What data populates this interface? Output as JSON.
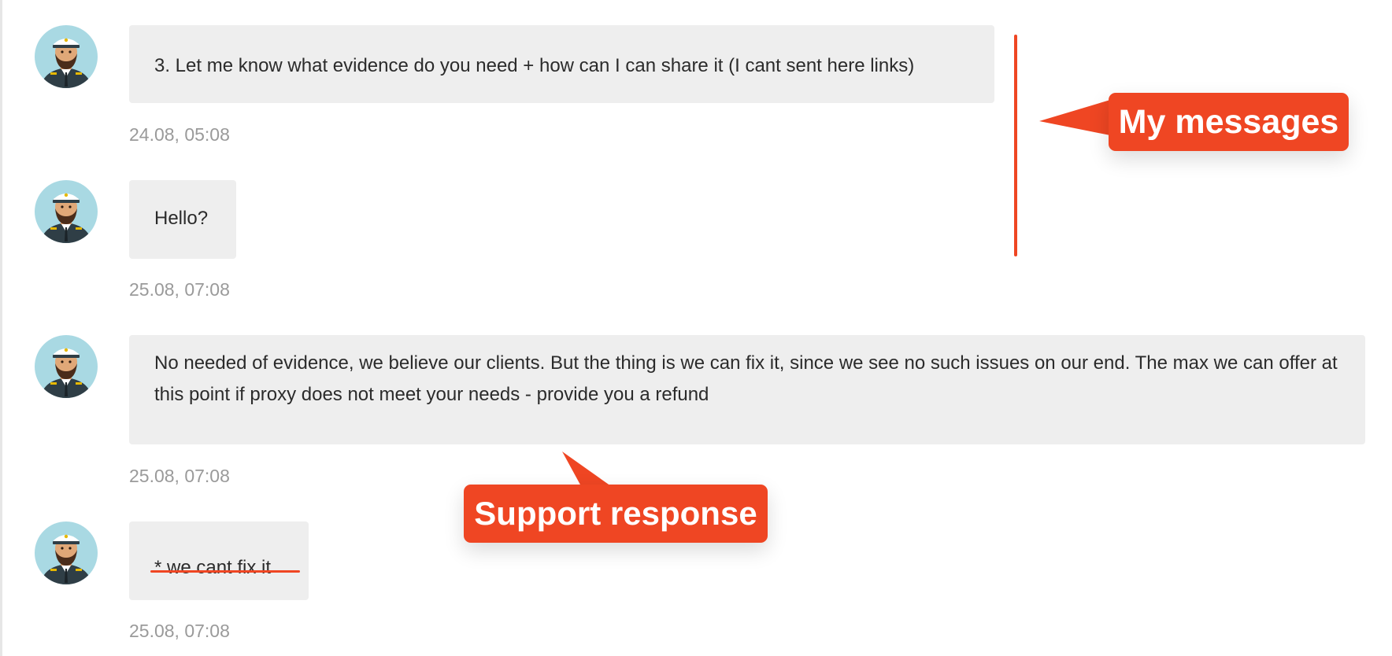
{
  "chat": {
    "messages": [
      {
        "text": "3. Let me know what evidence do you need + how can I can share it (I cant sent here links)",
        "time": "24.08, 05:08"
      },
      {
        "text": "Hello?",
        "time": "25.08, 07:08"
      },
      {
        "text": "No needed of evidence, we believe our clients. But the thing is we can fix it, since we see no such issues on our end. The max we can offer at this point if proxy does not meet your needs - provide you a refund",
        "time": "25.08, 07:08"
      },
      {
        "text": "* we cant fix it",
        "time": "25.08, 07:08"
      }
    ]
  },
  "annotations": {
    "my_messages": "My messages",
    "support_response": "Support response",
    "accent_color": "#ef4623"
  },
  "icons": {
    "avatar": "captain-avatar-icon"
  }
}
